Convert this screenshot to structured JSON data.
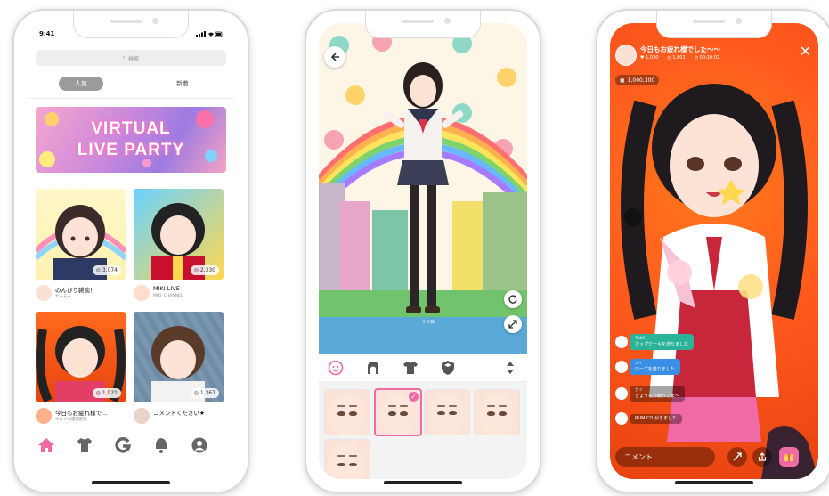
{
  "phone1": {
    "status_time": "9:41",
    "search_placeholder": "検索",
    "tabs": [
      {
        "label": "人気"
      },
      {
        "label": "新着"
      }
    ],
    "banner": {
      "line1": "VIRTUAL",
      "line2": "LIVE PARTY"
    },
    "cards": [
      {
        "title": "のんびり雑談！",
        "subtitle": "たーら★",
        "viewers": "3,074"
      },
      {
        "title": "MIKI LIVE",
        "subtitle": "MIKI_CHANNEL",
        "viewers": "2,330"
      },
      {
        "title": "今日もお疲れ様で...",
        "subtitle": "ウルジの雑談配信",
        "viewers": "1,921"
      },
      {
        "title": "コメントください★",
        "subtitle": "",
        "viewers": "1,367"
      }
    ],
    "nav": [
      "home-icon",
      "tshirt-icon",
      "g-icon",
      "bell-icon",
      "profile-icon"
    ]
  },
  "phone2": {
    "avatar_label": "つり目",
    "categories": [
      "face-icon",
      "hair-icon",
      "clothes-icon",
      "accessory-icon",
      "sort-icon"
    ],
    "selected_face": 1
  },
  "phone3": {
    "title": "今日もお疲れ様でした〜〜",
    "stats": {
      "hearts": "1,030",
      "viewers": "1,801",
      "time": "00:10:02"
    },
    "coins": "1,000,300",
    "chats": [
      {
        "name": "TAKA",
        "text": "カップケーキを送りました",
        "color": "#2bb39a"
      },
      {
        "name": "ルイ",
        "text": "ローズを送りました",
        "color": "#3a8ee6"
      },
      {
        "name": "カイ",
        "text": "きょうもお疲れさま〜",
        "color": "rgba(0,0,0,0.35)"
      },
      {
        "name": "RUMICO",
        "text": "がきました",
        "color": "rgba(0,0,0,0.35)"
      }
    ],
    "comment_placeholder": "コメント"
  }
}
